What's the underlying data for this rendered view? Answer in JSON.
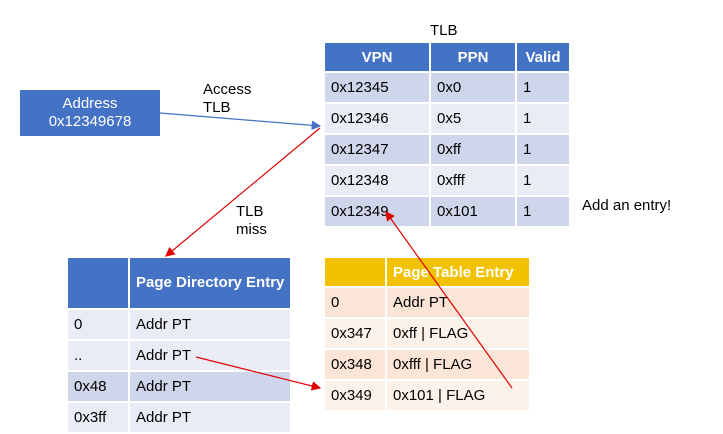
{
  "address": {
    "line1": "Address",
    "line2": "0x12349678"
  },
  "labels": {
    "access_tlb_1": "Access",
    "access_tlb_2": "TLB",
    "tlb_title": "TLB",
    "tlb_miss_1": "TLB",
    "tlb_miss_2": "miss",
    "add_entry": "Add an entry!"
  },
  "tlb": {
    "headers": [
      "VPN",
      "PPN",
      "Valid"
    ],
    "rows": [
      [
        "0x12345",
        "0x0",
        "1"
      ],
      [
        "0x12346",
        "0x5",
        "1"
      ],
      [
        "0x12347",
        "0xff",
        "1"
      ],
      [
        "0x12348",
        "0xfff",
        "1"
      ],
      [
        "0x12349",
        "0x101",
        "1"
      ]
    ]
  },
  "page_directory": {
    "headers": [
      "",
      "Page Directory Entry"
    ],
    "rows": [
      [
        "0",
        "Addr PT"
      ],
      [
        "..",
        "Addr PT"
      ],
      [
        "0x48",
        "Addr PT"
      ],
      [
        "0x3ff",
        "Addr PT"
      ]
    ]
  },
  "page_table": {
    "headers": [
      "",
      "Page Table Entry"
    ],
    "rows": [
      [
        "0",
        "Addr PT"
      ],
      [
        "0x347",
        "0xff | FLAG"
      ],
      [
        "0x348",
        "0xfff | FLAG"
      ],
      [
        "0x349",
        "0x101 | FLAG"
      ]
    ]
  },
  "colors": {
    "blue_header": "#4472C4",
    "arrow_blue": "#4472C4",
    "arrow_red": "#E00000",
    "gold_header": "#F2C200"
  }
}
